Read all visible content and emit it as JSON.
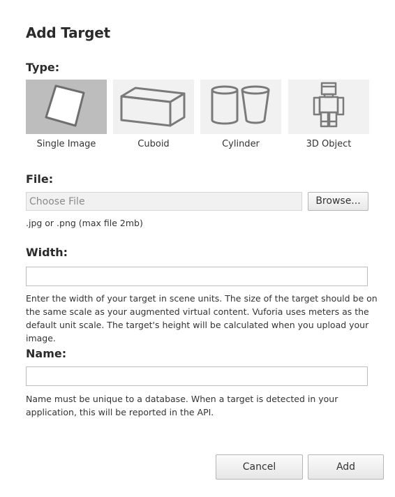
{
  "dialog": {
    "title": "Add Target"
  },
  "type_section": {
    "label": "Type:",
    "options": [
      {
        "label": "Single Image",
        "icon": "single-image-icon",
        "selected": true
      },
      {
        "label": "Cuboid",
        "icon": "cuboid-icon",
        "selected": false
      },
      {
        "label": "Cylinder",
        "icon": "cylinder-icon",
        "selected": false
      },
      {
        "label": "3D Object",
        "icon": "3d-object-icon",
        "selected": false
      }
    ]
  },
  "file_section": {
    "label": "File:",
    "placeholder": "Choose File",
    "browse_label": "Browse...",
    "hint": ".jpg or .png (max file 2mb)"
  },
  "width_section": {
    "label": "Width:",
    "value": "",
    "hint": "Enter the width of your target in scene units. The size of the target should be on the same scale as your augmented virtual content. Vuforia uses meters as the default unit scale. The target's height will be calculated when you upload your image."
  },
  "name_section": {
    "label": "Name:",
    "value": "",
    "hint": "Name must be unique to a database. When a target is detected in your application, this will be reported in the API."
  },
  "actions": {
    "cancel_label": "Cancel",
    "add_label": "Add"
  },
  "colors": {
    "selected_tile": "#bdbdbd",
    "tile": "#f1f1f1",
    "icon_stroke": "#7a7a7a"
  }
}
